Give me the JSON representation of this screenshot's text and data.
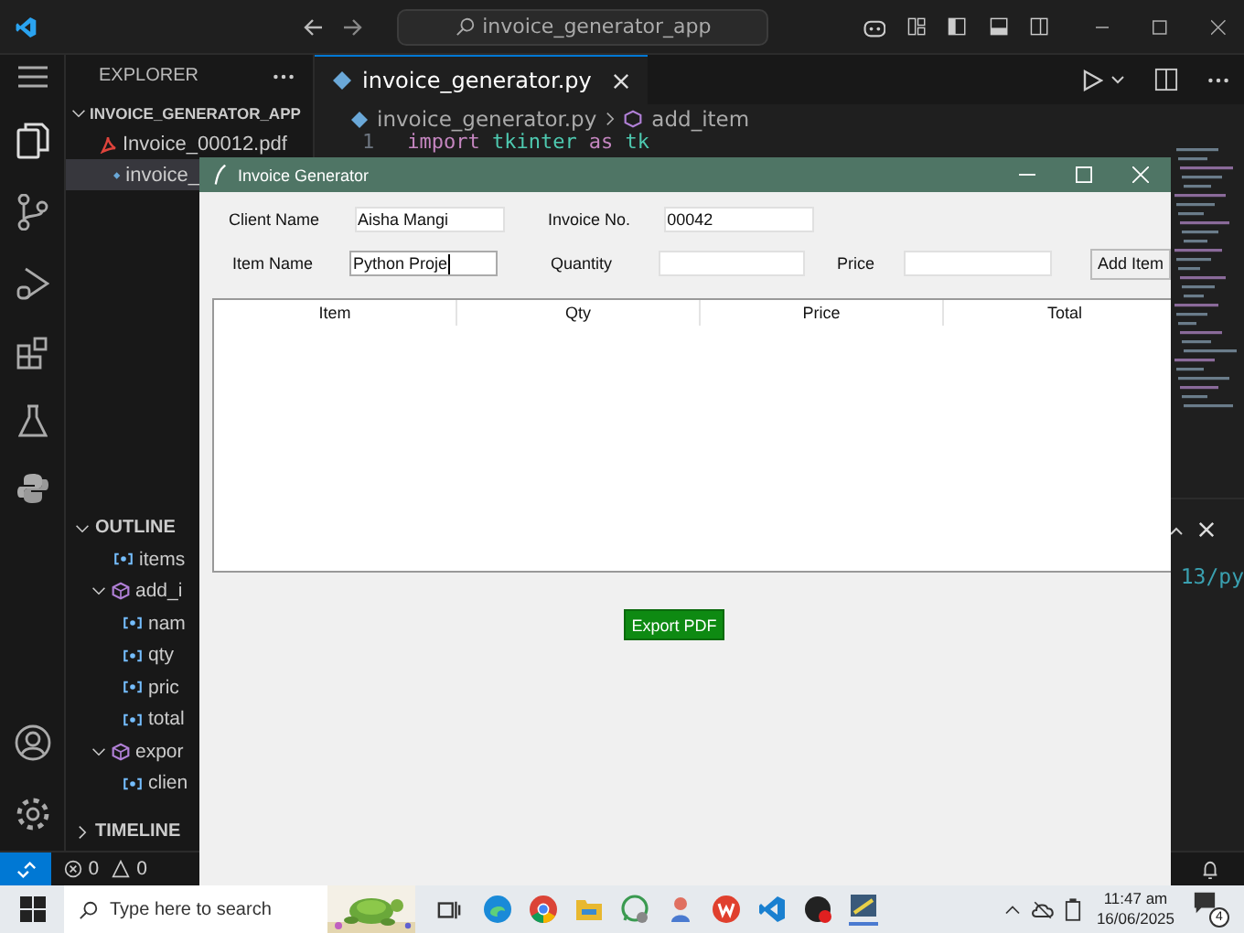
{
  "editor_window": {
    "search_text": "invoice_generator_app"
  },
  "explorer": {
    "title": "EXPLORER",
    "folder": "INVOICE_GENERATOR_APP",
    "files": [
      {
        "name": "Invoice_00012.pdf",
        "kind": "pdf",
        "selected": false
      },
      {
        "name": "invoice_",
        "kind": "python",
        "selected": true
      }
    ]
  },
  "outline": {
    "title": "OUTLINE",
    "items": [
      {
        "name": "items",
        "kind": "variable"
      },
      {
        "name": "add_i",
        "kind": "function",
        "expanded": true,
        "children": [
          {
            "name": "nam",
            "kind": "variable"
          },
          {
            "name": "qty",
            "kind": "variable"
          },
          {
            "name": "pric",
            "kind": "variable"
          },
          {
            "name": "total",
            "kind": "variable"
          }
        ]
      },
      {
        "name": "expor",
        "kind": "function",
        "expanded": true,
        "children": [
          {
            "name": "clien",
            "kind": "variable"
          }
        ]
      }
    ]
  },
  "timeline": {
    "title": "TIMELINE",
    "expanded": false
  },
  "tab": {
    "label": "invoice_generator.py",
    "selected": true
  },
  "breadcrumb": [
    "invoice_generator.py",
    "add_item"
  ],
  "code": [
    {
      "number": "1",
      "tokens": [
        {
          "text": "import",
          "kind": "keyword"
        },
        {
          "text": "tkinter",
          "kind": "name"
        },
        {
          "text": "as",
          "kind": "keyword"
        },
        {
          "text": "tk",
          "kind": "name"
        }
      ]
    }
  ],
  "terminal_text": "13/py",
  "status_bar": {
    "errors": "0",
    "warnings": "0"
  },
  "app_window": {
    "title": "Invoice Generator",
    "form_lines": [
      {
        "fields": [
          {
            "label": "Client Name",
            "value": "Aisha Mangi",
            "focused": false
          },
          {
            "label": "Invoice No.",
            "value": "00042",
            "focused": false
          }
        ]
      },
      {
        "fields": [
          {
            "label": "Item Name",
            "value": "Python Proje",
            "focused": true
          },
          {
            "label": "Quantity",
            "focused": false
          },
          {
            "label": "Price",
            "focused": false
          }
        ],
        "button": "Add Item"
      }
    ],
    "columns": [
      "Item",
      "Qty",
      "Price",
      "Total"
    ],
    "export_button": "Export PDF"
  },
  "taskbar": {
    "search_placeholder": "Type here to search",
    "time": "11:47 am",
    "date": "16/06/2025",
    "notifications": "4"
  }
}
